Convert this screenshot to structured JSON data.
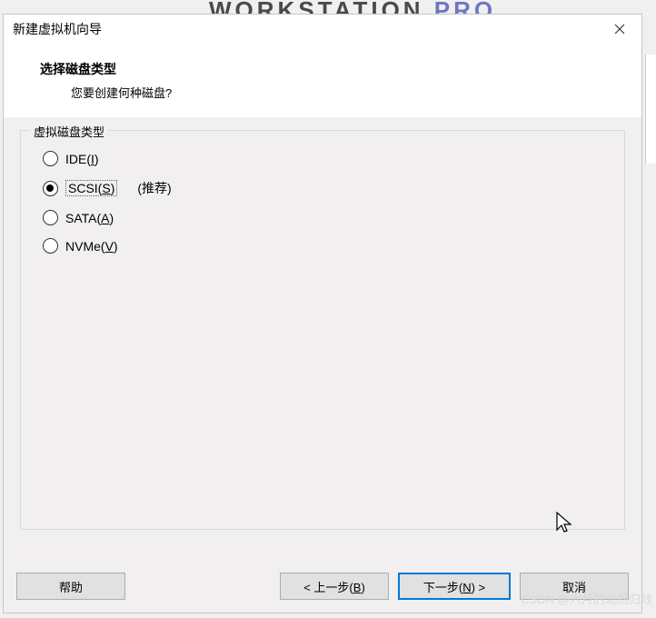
{
  "background": {
    "partial_text_before": "WORKSTATION ",
    "partial_text_red": "",
    "partial_text_after": " PRO"
  },
  "dialog": {
    "title": "新建虚拟机向导",
    "header_title": "选择磁盘类型",
    "header_subtitle": "您要创建何种磁盘?"
  },
  "group": {
    "legend": "虚拟磁盘类型",
    "options": [
      {
        "label_prefix": "IDE(",
        "accel": "I",
        "label_suffix": ")",
        "checked": false,
        "recommend": ""
      },
      {
        "label_prefix": "SCSI(",
        "accel": "S",
        "label_suffix": ")",
        "checked": true,
        "recommend": "(推荐)"
      },
      {
        "label_prefix": "SATA(",
        "accel": "A",
        "label_suffix": ")",
        "checked": false,
        "recommend": ""
      },
      {
        "label_prefix": "NVMe(",
        "accel": "V",
        "label_suffix": ")",
        "checked": false,
        "recommend": ""
      }
    ]
  },
  "buttons": {
    "help": "帮助",
    "back_prefix": "< 上一步(",
    "back_accel": "B",
    "back_suffix": ")",
    "next_prefix": "下一步(",
    "next_accel": "N",
    "next_suffix": ") >",
    "cancel": "取消"
  },
  "watermark": "CSDN @六月的北回归线"
}
